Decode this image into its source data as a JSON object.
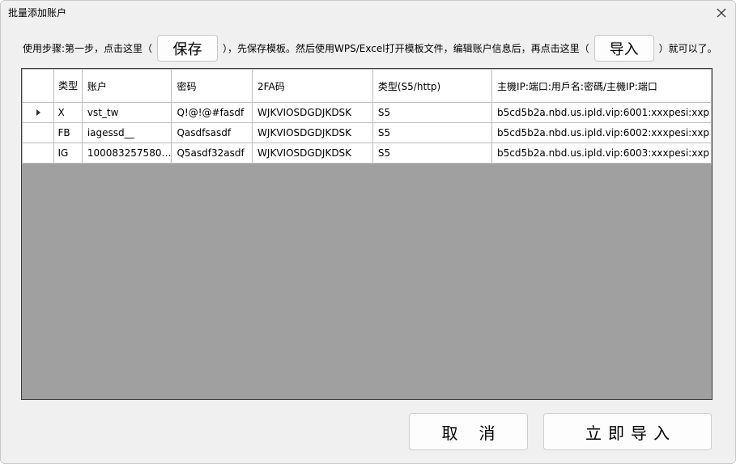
{
  "window": {
    "title": "批量添加账户"
  },
  "instructions": {
    "prefix": "使用步骤:第一步，点击这里（",
    "save_label": "保存",
    "middle": "），先保存模板。然后使用WPS/Excel打开模板文件，编辑账户信息后，再点击这里（",
    "import_label": "导入",
    "suffix": "）就可以了。"
  },
  "table": {
    "columns": [
      "",
      "类型",
      "账户",
      "密码",
      "2FA码",
      "类型(S5/http)",
      "主機IP:端口:用戶名:密碼/主機IP:端口"
    ],
    "rows": [
      {
        "pointer": true,
        "type": "X",
        "account": "vst_tw",
        "password": "Q!@!@#fasdf",
        "twofa": "WJKVIOSDGDJKDSK",
        "proxy_type": "S5",
        "host": "b5cd5b2a.nbd.us.ipld.vip:6001:xxxpesi:xxp"
      },
      {
        "pointer": false,
        "type": "FB",
        "account": "iagessd__",
        "password": "Qasdfsasdf",
        "twofa": "WJKVIOSDGDJKDSK",
        "proxy_type": "S5",
        "host": "b5cd5b2a.nbd.us.ipld.vip:6002:xxxpesi:xxp"
      },
      {
        "pointer": false,
        "type": "IG",
        "account": "100083257580…",
        "password": "Q5asdf32asdf",
        "twofa": "WJKVIOSDGDJKDSK",
        "proxy_type": "S5",
        "host": "b5cd5b2a.nbd.us.ipld.vip:6003:xxxpesi:xxp"
      }
    ]
  },
  "footer": {
    "cancel_label": "取消",
    "confirm_label": "立即导入"
  },
  "icons": {
    "close": "close-icon",
    "row_pointer": "row-pointer-icon"
  }
}
